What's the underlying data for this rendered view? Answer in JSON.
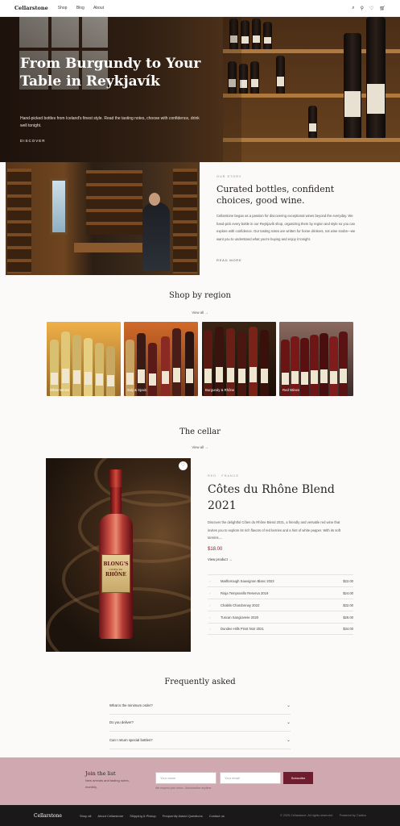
{
  "header": {
    "logo": "Cellarstone",
    "nav": [
      "Shop",
      "Blog",
      "About"
    ],
    "icons": [
      "search-icon",
      "user-icon",
      "heart-icon",
      "cart-icon"
    ]
  },
  "hero": {
    "title": "From Burgundy to Your Table in Reykjavík",
    "subtitle": "Hand-picked bottles from Iceland's finest style. Read the tasting notes, choose with confidence, drink well tonight.",
    "cta": "DISCOVER"
  },
  "story": {
    "eyebrow": "OUR STORY",
    "title": "Curated bottles, confident choices, good wine.",
    "body": "Cellarstone began as a passion for discovering exceptional wines beyond the everyday. We hand-pick every bottle in our Reykjavík shop, organizing them by region and style so you can explore with confidence. Our tasting notes are written for home drinkers, not wine snobs—we want you to understand what you're buying and enjoy it tonight.",
    "cta": "READ MORE"
  },
  "regions": {
    "title": "Shop by region",
    "view_all": "View all",
    "items": [
      {
        "label": "White Wines"
      },
      {
        "label": "Italy & Spain"
      },
      {
        "label": "Burgundy & Rhône"
      },
      {
        "label": "Red Wines"
      }
    ]
  },
  "cellar": {
    "title": "The cellar",
    "view_all": "View all",
    "featured": {
      "eyebrow": "RED · FRANCE",
      "title": "Côtes du Rhône Blend 2021",
      "description": "Discover the delightful Côtes du Rhône Blend 2021, a friendly and versatile red wine that invites you to explore its rich flavors of red berries and a hint of white pepper. With its soft tannins,...",
      "price": "$18.00",
      "link": "View product",
      "label_line1": "BLONG'S",
      "label_line2": "CÔTES DU",
      "label_line3": "RHÔNE"
    },
    "list": [
      {
        "name": "Marlborough Sauvignon Blanc 2023",
        "price": "$22.00"
      },
      {
        "name": "Rioja Tempranillo Reserva 2019",
        "price": "$24.00"
      },
      {
        "name": "Chablis Chardonnay 2022",
        "price": "$32.00"
      },
      {
        "name": "Tuscan Sangiovese 2020",
        "price": "$26.00"
      },
      {
        "name": "Dundee Hills Pinot Noir 2021",
        "price": "$34.00"
      }
    ]
  },
  "faq": {
    "title": "Frequently asked",
    "items": [
      {
        "q": "What is the minimum order?"
      },
      {
        "q": "Do you deliver?"
      },
      {
        "q": "Can I return special bottles?"
      }
    ]
  },
  "newsletter": {
    "title": "Join the list",
    "subtitle": "New arrivals and tasting notes, monthly.",
    "first_placeholder": "Your name",
    "email_placeholder": "Your email",
    "button": "Subscribe",
    "note": "We respect your inbox. Unsubscribe anytime."
  },
  "footer": {
    "logo": "Cellarstone",
    "links": [
      "Shop all",
      "About Cellarstone",
      "Shipping & Pickup",
      "Frequently Asked Questions",
      "Contact us"
    ],
    "copyright": "© 2025 Cellarstone. All rights reserved.",
    "powered": "Powered by Cartico"
  },
  "colors": {
    "accent": "#6e1c2e",
    "price": "#8a1c2c",
    "newsletter_bg": "#cfa8b0",
    "footer_bg": "#1b1819"
  }
}
